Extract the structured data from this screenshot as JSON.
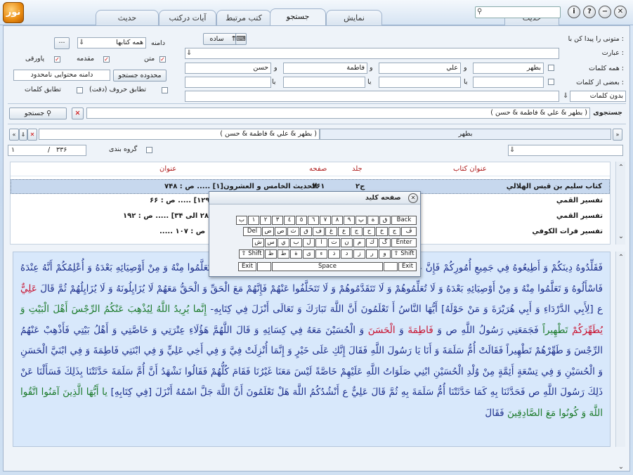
{
  "app": {
    "logo": "نور"
  },
  "tabs": [
    {
      "label": "نمایش"
    },
    {
      "label": "جستجو"
    },
    {
      "label": "کتب مرتبط"
    },
    {
      "label": "آیات درکتب"
    },
    {
      "label": "حدیث"
    }
  ],
  "window_buttons": {
    "close": "✕",
    "min": "−",
    "help": "?",
    "info": "i"
  },
  "search": {
    "find_label": "متونی را پیدا کن با :",
    "phrase_label": "عبارت :",
    "all_words_label": "همه کلمات :",
    "some_words_label": "بعضی از کلمات :",
    "mode": "ساده",
    "phrase_value": "",
    "all_words": [
      "بطهر",
      "علي",
      "فاطمة",
      "حسن"
    ],
    "and_word": "و",
    "or_word": "یا",
    "without_words": "بدون کلمات",
    "domain_label": "دامنه",
    "domain_value": "همه کتابها",
    "opt_text": "متن",
    "opt_intro": "مقدمه",
    "opt_footnote": "پاورقی",
    "scope_button": "محدوده جستجو",
    "scope_value": "دامنه محتوایی نامحدود",
    "exact_letters": "تطابق حروف (دقت)",
    "exact_words": "تطابق كلمات",
    "search_label": "جستجوی",
    "search_query": "( بطهر & علي & فاطمة & حسن )",
    "search_button": "جستجو"
  },
  "filter": {
    "query": "( بطهر & علي & فاطمة & حسن )",
    "term": "بطهر"
  },
  "group_label": "گروه بندی",
  "paging": {
    "total": "۳۳۶",
    "current": "۱"
  },
  "results": {
    "headers": {
      "book": "عنوان کتاب",
      "volume": "جلد",
      "page": "صفحه",
      "title": "عنوان"
    },
    "rows": [
      {
        "book": "کتاب سليم بن قيس الهلالي",
        "volume": "ج۲",
        "page": "۷۶۱",
        "title": "الحديث الخامس و العشرون[۱] ..... ص : ۷۴۸"
      },
      {
        "book": "تفسير القمي",
        "volume": "",
        "page": "",
        "title": "ت ۱۲۸ الی ۱۲۹] ..... ص : ۶۶"
      },
      {
        "book": "تفسير القمي",
        "volume": "",
        "page": "",
        "title": "ت ۲۸ الی ۳۴] ..... ص : ۱۹۲"
      },
      {
        "book": "تفسير فرات الكوفي",
        "volume": "",
        "page": "",
        "title": "..... ص : ۱۰۷"
      }
    ]
  },
  "keyboard": {
    "title": "صفحه کلید",
    "row1": [
      "Back",
      "ق",
      "ة",
      "پ",
      "٩",
      "٨",
      "٧",
      "٦",
      "٥",
      "٤",
      "٣",
      "٢",
      "١",
      "ب"
    ],
    "row2": [
      "ڤ",
      "ج",
      "خ",
      "ح",
      "ج",
      "ع",
      "غ",
      "ف",
      "ق",
      "ث",
      "ص",
      "ض",
      "Del"
    ],
    "row3": [
      "Enter",
      "گ",
      "ك",
      "م",
      "ن",
      "ت",
      "ا",
      "ل",
      "ب",
      "ي",
      "س",
      "ش"
    ],
    "row4": [
      "⇧ Shift",
      "و",
      "ر",
      "ز",
      "د",
      "ذ",
      "ء",
      "ى",
      "ة",
      "ط",
      "ظ",
      "⇧ Shift"
    ],
    "row5": [
      "Exit",
      "",
      "Space",
      "",
      "Exit"
    ]
  },
  "passage": {
    "line1": "فَقَلِّدُوهُ دِينَكُمْ وَ أَطِيعُوهُ فِي جَمِيعِ أُمُورِكُمْ فَإِنَّ عِنْدَهُ جَمِيعَ مَا عَلَّمَنِيَ اللَّهُ مِنْ عِلْمِهِ وَ حِكْمَتِهِ فَسَلُوهُ وَ تَعَلَّمُوا مِنْهُ وَ مِنْ أَوْصِيَائِهِ بَعْدَهُ وَ أُعْلِمُكُمْ أَنَّهُ عِنْدَهُ فَاسْأَلُوهُ وَ تَعَلَّمُوا مِنْهُ وَ مِنْ",
    "line2": "أَوْصِيَائِهِ بَعْدَهُ وَ لَا تُعَلِّمُوهُمْ وَ لَا تَتَقَدَّمُوهُمْ وَ لَا تَتَخَلَّفُوا عَنْهُمْ فَإِنَّهُمْ مَعَ الْحَقِّ وَ الْحَقُّ مَعَهُمْ لَا يُزَايِلُونَهُ وَ لَا يُزَايِلُهُمْ ثُمَّ قَالَ",
    "ali": "عَلِيٌّ",
    "line2b": "ع [لِأَبِي الدَّرْدَاءِ وَ أَبِي هُرَيْرَةَ وَ مَنْ حَوْلَهُ] أَيُّهَا النَّاسُ أَ تَعْلَمُونَ أَنَّ اللَّهَ تَبَارَكَ وَ تَعَالَى أَنْزَلَ فِي كِتَابِهِ-",
    "verse1": "إِنَّما يُرِيدُ اللَّهُ لِيُذْهِبَ عَنْكُمُ الرِّجْسَ أَهْلَ الْبَيْتِ وَ",
    "yutahhir": "يُطَهِّرَكُمْ",
    "verse1b": "تَطْهِيراً",
    "line3": "فَجَمَعَنِي رَسُولُ اللَّهِ ص وَ",
    "fatima": "فَاطِمَةَ",
    "line3b": "وَ",
    "hasan": "الْحَسَنَ",
    "line3c": "وَ الْحُسَيْنَ مَعَهُ فِي كِسَائِهِ وَ قَالَ اللَّهُمَّ هَؤُلَاءِ عِتْرَتِي وَ خَاصَّتِي وَ أَهْلُ بَيْتِي فَأَذْهِبْ عَنْهُمُ الرِّجْسَ وَ طَهِّرْهُمْ تَطْهِيراً فَقَالَتْ أُمُّ سَلَمَةَ وَ أَنَا يَا رَسُولَ اللَّهِ فَقَالَ إِنَّكِ عَلَى خَيْرٍ وَ إِنَّمَا أُنْزِلَتْ فِيَّ وَ فِي أَخِي عَلِيٍّ وَ فِي ابْنَتِي فَاطِمَةَ وَ فِي ابْنَيَّ الْحَسَنِ وَ الْحُسَيْنِ وَ فِي تِسْعَةٍ أَئِمَّةٍ مِنْ وُلْدِ الْحُسَيْنِ ابْنِي صَلَوَاتُ اللَّهِ عَلَيْهِمْ خَاصَّةً لَيْسَ مَعَنَا غَيْرُنَا فَقَامَ كُلُّهُمْ فَقَالُوا نَشْهَدُ أَنَّ أُمَّ سَلَمَةَ حَدَّثَتْنَا بِذَلِكَ فَسَأَلْنَا عَنْ ذَلِكَ رَسُولَ اللَّهِ ص فَحَدَّثَنَا بِهِ كَمَا حَدَّثَتْنَا أُمُّ سَلَمَةَ بِهِ ثُمَّ قَالَ عَلِيٌّ ع أَنْشُدُكُمُ اللَّهَ هَلْ تَعْلَمُونَ أَنَّ اللَّهَ جَلَّ اسْمُهُ أَنْزَلَ [فِي كِتَابِهِ]",
    "verse2": "يا أَيُّهَا الَّذِينَ آمَنُوا اتَّقُوا اللَّهَ وَ كُونُوا مَعَ الصَّادِقِينَ",
    "line4": "فَقَالَ"
  }
}
